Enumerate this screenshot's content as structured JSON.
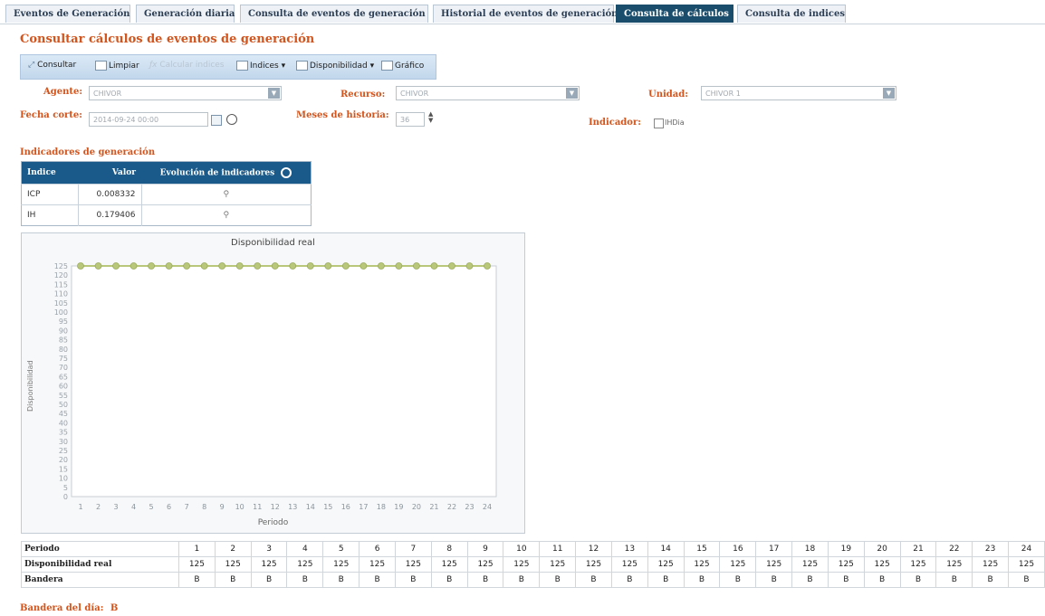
{
  "tabs": [
    "Eventos de Generación",
    "Generación diaria",
    "Consulta de eventos de generación",
    "Historial de eventos de generación",
    "Consulta de cálculos",
    "Consulta de indices"
  ],
  "active_tab": "Consulta de cálculos",
  "page_title": "Consultar cálculos de eventos de generación",
  "toolbar": {
    "consultar": "Consultar",
    "limpiar": "Limpiar",
    "calcular_indices": "Calcular indices",
    "indices": "Indices",
    "disponibilidad": "Disponibilidad",
    "grafico": "Gráfico"
  },
  "form": {
    "agente_label": "Agente:",
    "agente_value": "CHIVOR",
    "recurso_label": "Recurso:",
    "recurso_value": "CHIVOR",
    "unidad_label": "Unidad:",
    "unidad_value": "CHIVOR 1",
    "fecha_corte_label": "Fecha corte:",
    "fecha_corte_value": "2014-09-24 00:00",
    "meses_label": "Meses de historia:",
    "meses_value": "36",
    "indicador_label": "Indicador:",
    "indicador_option": "IHDia"
  },
  "indicators": {
    "title": "Indicadores de generación",
    "headers": [
      "Indice",
      "Valor",
      "Evolución de indicadores"
    ],
    "rows": [
      {
        "indice": "ICP",
        "valor": "0.008332"
      },
      {
        "indice": "IH",
        "valor": "0.179406"
      }
    ]
  },
  "chart_data": {
    "type": "line",
    "title": "Disponibilidad real",
    "xlabel": "Periodo",
    "ylabel": "Disponibilidad",
    "x": [
      1,
      2,
      3,
      4,
      5,
      6,
      7,
      8,
      9,
      10,
      11,
      12,
      13,
      14,
      15,
      16,
      17,
      18,
      19,
      20,
      21,
      22,
      23,
      24
    ],
    "series": [
      {
        "values": [
          125,
          125,
          125,
          125,
          125,
          125,
          125,
          125,
          125,
          125,
          125,
          125,
          125,
          125,
          125,
          125,
          125,
          125,
          125,
          125,
          125,
          125,
          125,
          125
        ]
      }
    ],
    "ylim": [
      0,
      125
    ],
    "yticks": [
      0,
      5,
      10,
      15,
      20,
      25,
      30,
      35,
      40,
      45,
      50,
      55,
      60,
      65,
      70,
      75,
      80,
      85,
      90,
      95,
      100,
      105,
      110,
      115,
      120,
      125
    ],
    "grid": false,
    "color": "#b8c77a"
  },
  "data_table": {
    "row_headers": [
      "Periodo",
      "Disponibilidad real",
      "Bandera"
    ],
    "periodo": [
      "1",
      "2",
      "3",
      "4",
      "5",
      "6",
      "7",
      "8",
      "9",
      "10",
      "11",
      "12",
      "13",
      "14",
      "15",
      "16",
      "17",
      "18",
      "19",
      "20",
      "21",
      "22",
      "23",
      "24"
    ],
    "disponibilidad": [
      "125",
      "125",
      "125",
      "125",
      "125",
      "125",
      "125",
      "125",
      "125",
      "125",
      "125",
      "125",
      "125",
      "125",
      "125",
      "125",
      "125",
      "125",
      "125",
      "125",
      "125",
      "125",
      "125",
      "125"
    ],
    "bandera": [
      "B",
      "B",
      "B",
      "B",
      "B",
      "B",
      "B",
      "B",
      "B",
      "B",
      "B",
      "B",
      "B",
      "B",
      "B",
      "B",
      "B",
      "B",
      "B",
      "B",
      "B",
      "B",
      "B",
      "B"
    ]
  },
  "day_flag": {
    "label": "Bandera del día:",
    "value": "B"
  }
}
